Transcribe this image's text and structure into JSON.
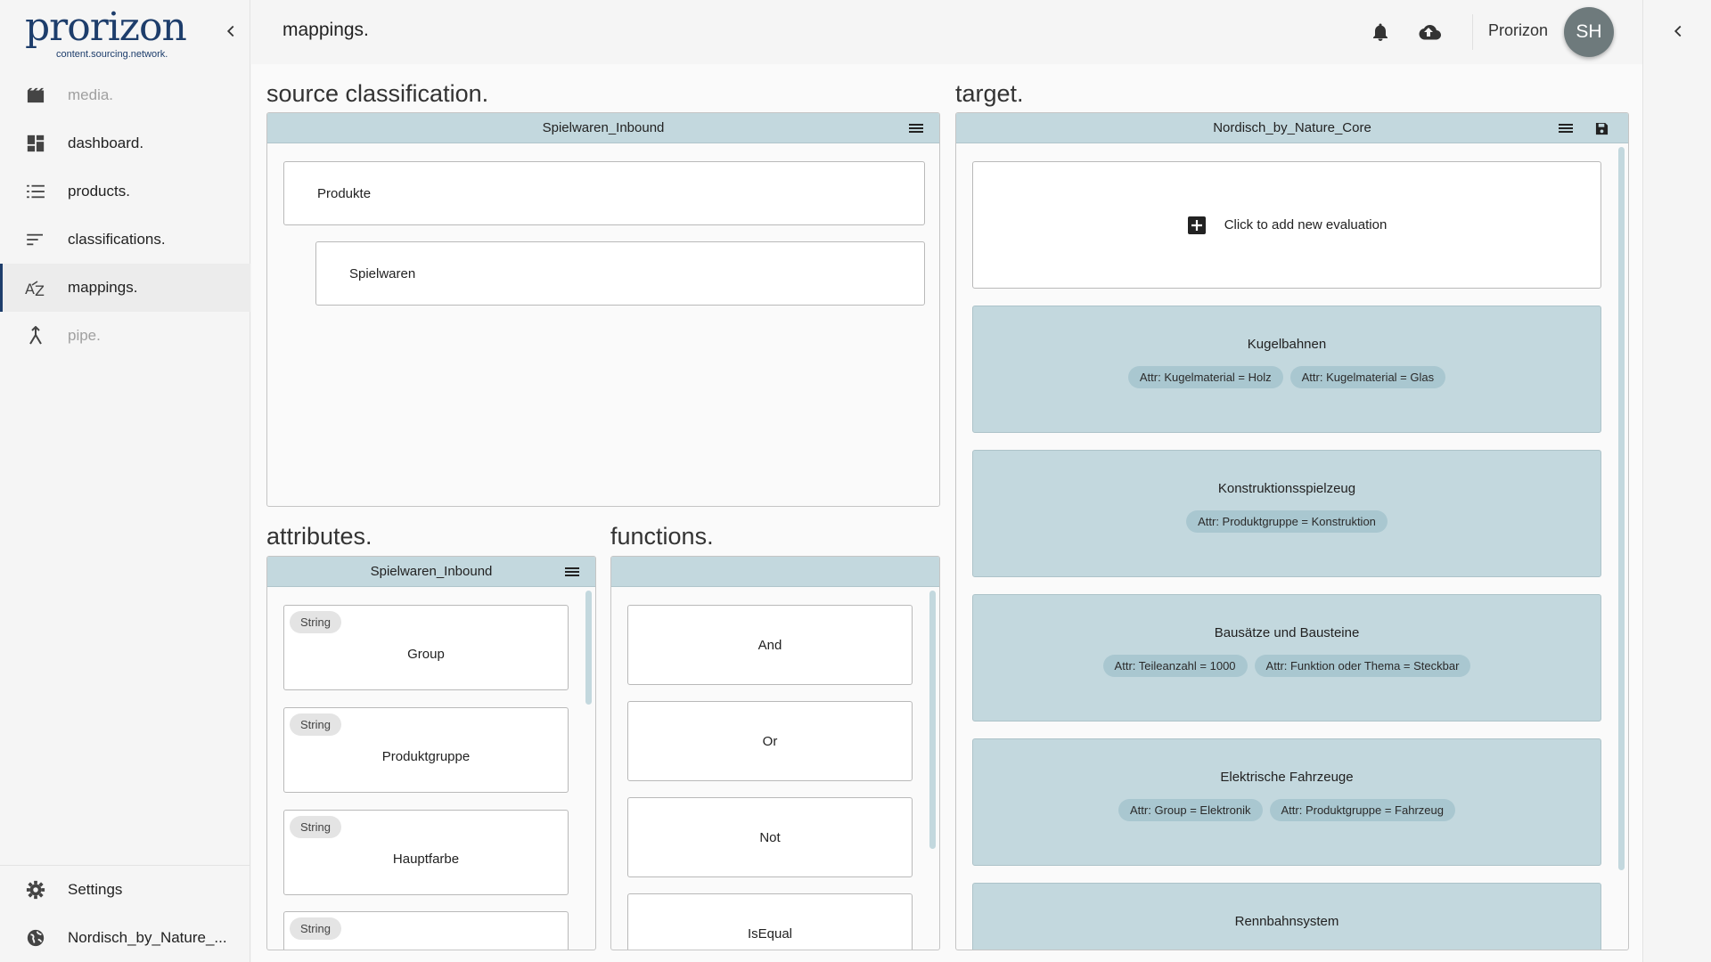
{
  "brand": {
    "name": "prorizon",
    "tagline": "content.sourcing.network."
  },
  "sidebar": {
    "items": [
      {
        "label": "media.",
        "icon": "movie-icon",
        "state": "disabled"
      },
      {
        "label": "dashboard.",
        "icon": "dashboard-icon",
        "state": "normal"
      },
      {
        "label": "products.",
        "icon": "list-icon",
        "state": "normal"
      },
      {
        "label": "classifications.",
        "icon": "sort-icon",
        "state": "normal"
      },
      {
        "label": "mappings.",
        "icon": "sort-by-alpha-icon",
        "state": "active"
      },
      {
        "label": "pipe.",
        "icon": "merge-icon",
        "state": "disabled"
      }
    ],
    "settings_label": "Settings",
    "workspace_label": "Nordisch_by_Nature_..."
  },
  "header": {
    "title": "mappings.",
    "user_name": "Prorizon",
    "avatar_initials": "SH"
  },
  "source": {
    "title": "source classification.",
    "panel_name": "Spielwaren_Inbound",
    "nodes": [
      "Produkte",
      "Spielwaren"
    ]
  },
  "attributes": {
    "title": "attributes.",
    "panel_name": "Spielwaren_Inbound",
    "items": [
      {
        "type": "String",
        "name": "Group"
      },
      {
        "type": "String",
        "name": "Produktgruppe"
      },
      {
        "type": "String",
        "name": "Hauptfarbe"
      },
      {
        "type": "String",
        "name": ""
      }
    ]
  },
  "functions": {
    "title": "functions.",
    "items": [
      "And",
      "Or",
      "Not",
      "IsEqual"
    ]
  },
  "target": {
    "title": "target.",
    "panel_name": "Nordisch_by_Nature_Core",
    "add_label": "Click to add new evaluation",
    "cards": [
      {
        "name": "Kugelbahnen",
        "chips": [
          "Attr: Kugelmaterial = Holz",
          "Attr: Kugelmaterial = Glas"
        ]
      },
      {
        "name": "Konstruktionsspielzeug",
        "chips": [
          "Attr: Produktgruppe = Konstruktion"
        ]
      },
      {
        "name": "Bausätze und Bausteine",
        "chips": [
          "Attr: Teileanzahl = 1000",
          "Attr: Funktion oder Thema = Steckbar"
        ]
      },
      {
        "name": "Elektrische Fahrzeuge",
        "chips": [
          "Attr: Group = Elektronik",
          "Attr: Produktgruppe = Fahrzeug"
        ]
      },
      {
        "name": "Rennbahnsystem",
        "chips": []
      }
    ]
  },
  "colors": {
    "brand": "#1d3d6b",
    "panel_header": "#c3d8de",
    "target_card": "#c3d8de",
    "target_chip": "#a9c7d0",
    "avatar": "#6e7a7c"
  }
}
